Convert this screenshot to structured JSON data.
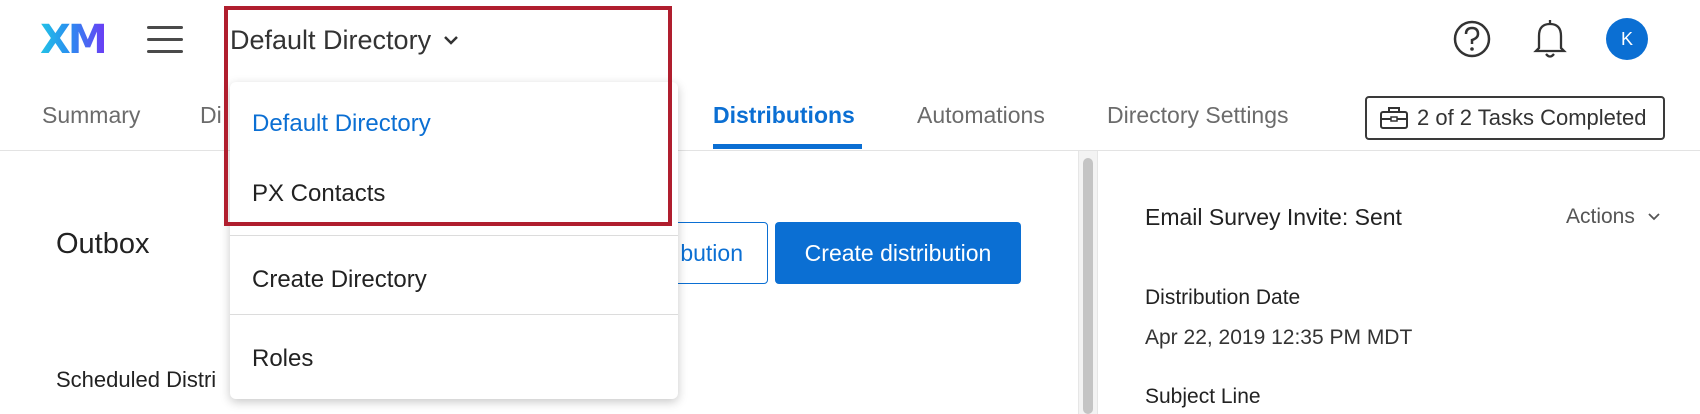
{
  "header": {
    "logo": "XM",
    "directory_label": "Default Directory",
    "avatar_initial": "K"
  },
  "tabs": [
    {
      "label": "Summary"
    },
    {
      "label": "Di"
    },
    {
      "label": "Distributions"
    },
    {
      "label": "Automations"
    },
    {
      "label": "Directory Settings"
    }
  ],
  "tasks": {
    "label": "2 of 2 Tasks Completed"
  },
  "dropdown": {
    "items": [
      {
        "label": "Default Directory"
      },
      {
        "label": "PX Contacts"
      },
      {
        "label": "Create Directory"
      },
      {
        "label": "Roles"
      }
    ]
  },
  "outbox": {
    "title": "Outbox",
    "scheduled_label": "Scheduled Distri",
    "partial_button_label": "bution",
    "create_button_label": "Create distribution"
  },
  "details": {
    "title": "Email Survey Invite: Sent",
    "actions_label": "Actions",
    "distribution_date_label": "Distribution Date",
    "distribution_date_value": "Apr 22, 2019 12:35 PM MDT",
    "subject_line_label": "Subject Line"
  },
  "colors": {
    "accent": "#0b6fd3",
    "highlight": "#b01e2e"
  }
}
